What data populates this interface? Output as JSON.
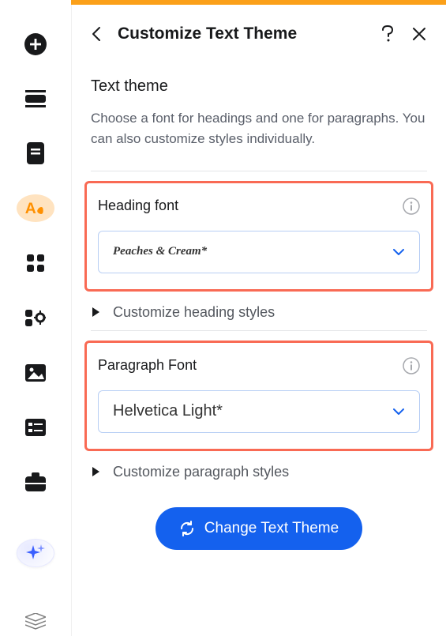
{
  "header": {
    "title": "Customize Text Theme"
  },
  "section": {
    "title": "Text theme",
    "description": "Choose a font for headings and one for paragraphs. You can also customize styles individually."
  },
  "heading_block": {
    "title": "Heading font",
    "selected": "Peaches & Cream*",
    "expand_label": "Customize heading styles"
  },
  "paragraph_block": {
    "title": "Paragraph Font",
    "selected": "Helvetica Light*",
    "expand_label": "Customize paragraph styles"
  },
  "cta": {
    "label": "Change Text Theme"
  },
  "colors": {
    "accent": "#1461ee",
    "highlight_border": "#f96a54",
    "active_bg": "#ffe3c0"
  }
}
